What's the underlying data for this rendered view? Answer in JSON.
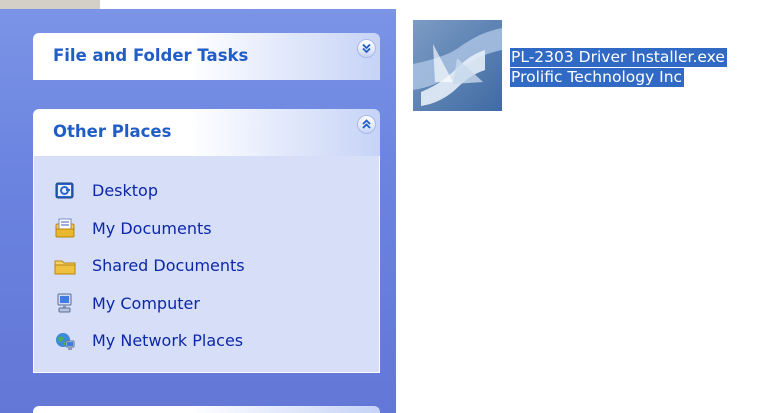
{
  "task_panels": {
    "file_folder_tasks": {
      "title": "File and Folder Tasks",
      "toggle_icon": "chevron-double-down-icon"
    },
    "other_places": {
      "title": "Other Places",
      "toggle_icon": "chevron-double-up-icon",
      "items": [
        {
          "label": "Desktop",
          "icon": "desktop-icon"
        },
        {
          "label": "My Documents",
          "icon": "my-documents-icon"
        },
        {
          "label": "Shared Documents",
          "icon": "shared-documents-icon"
        },
        {
          "label": "My Computer",
          "icon": "my-computer-icon"
        },
        {
          "label": "My Network Places",
          "icon": "network-places-icon"
        }
      ]
    }
  },
  "file_view": {
    "selected_item": {
      "name": "PL-2303 Driver Installer.exe",
      "company": "Prolific Technology Inc",
      "icon": "installer-icon"
    }
  },
  "colors": {
    "sidebar_blue": "#6b84e0",
    "panel_title": "#215dc6",
    "link_text": "#0c27a8",
    "selection": "#316ac5"
  }
}
